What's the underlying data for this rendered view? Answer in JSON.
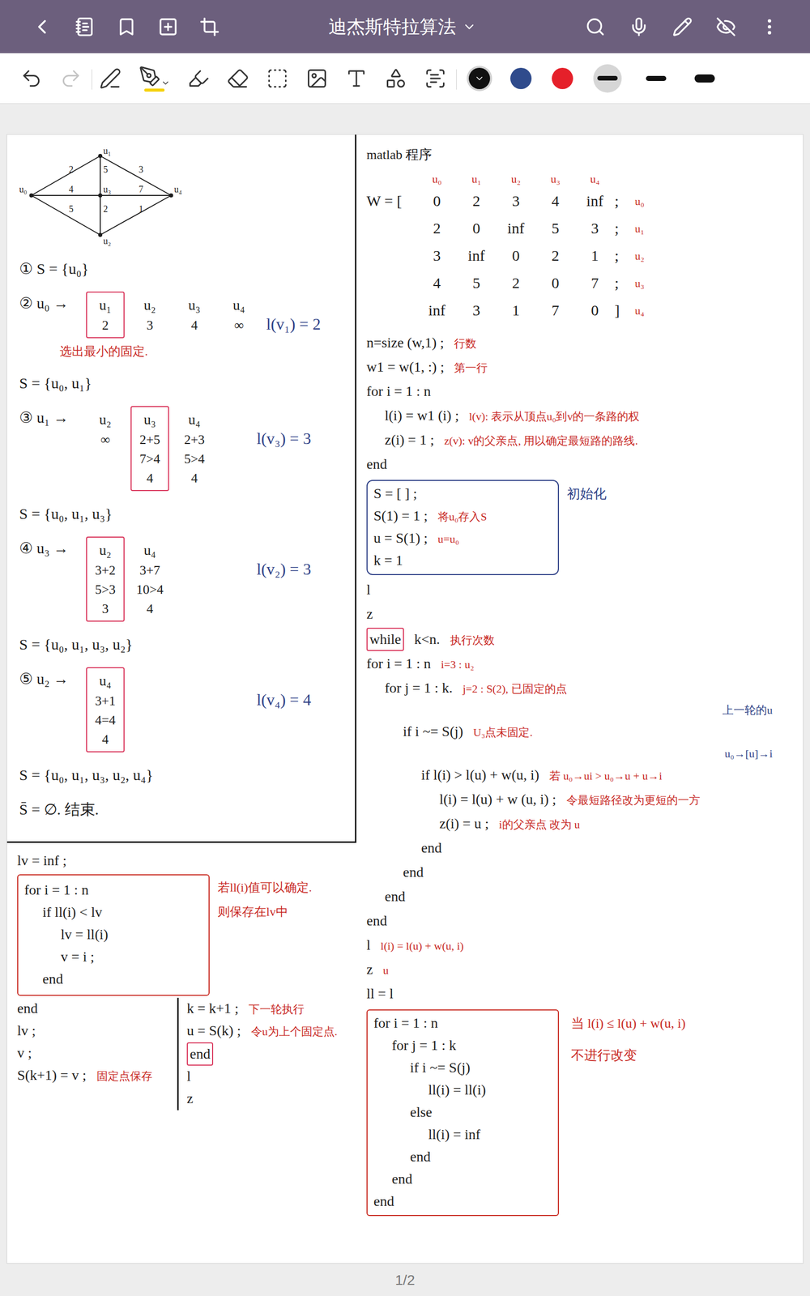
{
  "window": {
    "title": "迪杰斯特拉算法"
  },
  "toolbar": {
    "tools": [
      {
        "selected": false,
        "disabled": false
      },
      {
        "selected": false,
        "disabled": true
      },
      {
        "selected": false,
        "disabled": false
      },
      {
        "selected": true,
        "disabled": false
      },
      {
        "selected": false,
        "disabled": false
      },
      {
        "selected": false,
        "disabled": false
      },
      {
        "selected": false,
        "disabled": false
      },
      {
        "selected": false,
        "disabled": false
      },
      {
        "selected": false,
        "disabled": false
      },
      {
        "selected": false,
        "disabled": false
      },
      {
        "selected": false,
        "disabled": false
      }
    ],
    "colors": [
      {
        "color": "#111111",
        "selected": true
      },
      {
        "color": "#2f4b8c",
        "selected": false
      },
      {
        "color": "#e5202a",
        "selected": false
      }
    ],
    "strokes": [
      {
        "level": 0.4,
        "selected": true
      },
      {
        "level": 0.5,
        "selected": false
      },
      {
        "level": 1,
        "selected": false
      }
    ]
  },
  "graph": {
    "nodes": [
      {
        "label": "u₀"
      },
      {
        "label": "u₁"
      },
      {
        "label": "u₂"
      },
      {
        "label": "u₃"
      },
      {
        "label": "u₄"
      }
    ],
    "edges": [
      {
        "from": 0,
        "to": 1,
        "weight": "2"
      },
      {
        "from": 1,
        "to": 4,
        "weight": "3"
      },
      {
        "from": 0,
        "to": 2,
        "weight": "5"
      },
      {
        "from": 2,
        "to": 4,
        "weight": "1"
      },
      {
        "from": 1,
        "to": 3,
        "weight": "5"
      },
      {
        "from": 3,
        "to": 4,
        "weight": "7"
      },
      {
        "from": 0,
        "to": 3,
        "weight": "4"
      },
      {
        "from": 3,
        "to": 2,
        "weight": "2"
      }
    ]
  },
  "steps": [
    {
      "kind": "line",
      "text": "① S = {u₀}"
    },
    {
      "kind": "step",
      "label": "② u₀ →",
      "columns": [
        {
          "head": "u₁",
          "values": [
            "2"
          ],
          "boxed": true
        },
        {
          "head": "u₂",
          "values": [
            "3"
          ],
          "boxed": false
        },
        {
          "head": "u₃",
          "values": [
            "4"
          ],
          "boxed": false
        },
        {
          "head": "u₄",
          "values": [
            "∞"
          ],
          "boxed": false
        }
      ],
      "note": "选出最小的固定.",
      "result": "l(v₁) = 2"
    },
    {
      "kind": "line",
      "text": "S = {u₀, u₁}"
    },
    {
      "kind": "step",
      "label": "③ u₁ →",
      "columns": [
        {
          "head": "u₂",
          "values": [
            "∞"
          ],
          "boxed": false
        },
        {
          "head": "u₃",
          "values": [
            "2+5",
            "7>4",
            "4"
          ],
          "boxed": true
        },
        {
          "head": "u₄",
          "values": [
            "2+3",
            "5>4",
            "4"
          ],
          "boxed": false
        }
      ],
      "result": "l(v₃) = 3"
    },
    {
      "kind": "line",
      "text": "S = {u₀, u₁, u₃}"
    },
    {
      "kind": "step",
      "label": "④ u₃ →",
      "columns": [
        {
          "head": "u₂",
          "values": [
            "3+2",
            "5>3",
            "3"
          ],
          "boxed": true
        },
        {
          "head": "u₄",
          "values": [
            "3+7",
            "10>4",
            "4"
          ],
          "boxed": false
        }
      ],
      "result": "l(v₂) = 3"
    },
    {
      "kind": "line",
      "text": "S = {u₀, u₁, u₃, u₂}"
    },
    {
      "kind": "step",
      "label": "⑤ u₂ →",
      "columns": [
        {
          "head": "u₄",
          "values": [
            "3+1",
            "4=4",
            "4"
          ],
          "boxed": true
        }
      ],
      "result": "l(v₄) = 4"
    },
    {
      "kind": "line",
      "text": "S = {u₀, u₁, u₃, u₂, u₄}"
    },
    {
      "kind": "line",
      "text": "S̄ = ∅. 结束."
    }
  ],
  "program": {
    "title": "matlab 程序",
    "matrix": {
      "name": "W = [",
      "col_heads": [
        "u₀",
        "u₁",
        "u₂",
        "u₃",
        "u₄"
      ],
      "rows": [
        {
          "cells": [
            "0",
            "2",
            "3",
            "4",
            "inf"
          ],
          "end": ";",
          "label": "u₀"
        },
        {
          "cells": [
            "2",
            "0",
            "inf",
            "5",
            "3"
          ],
          "end": ";",
          "label": "u₁"
        },
        {
          "cells": [
            "3",
            "inf",
            "0",
            "2",
            "1"
          ],
          "end": ";",
          "label": "u₂"
        },
        {
          "cells": [
            "4",
            "5",
            "2",
            "0",
            "7"
          ],
          "end": ";",
          "label": "u₃"
        },
        {
          "cells": [
            "inf",
            "3",
            "1",
            "7",
            "0"
          ],
          "end": "]",
          "label": "u₄"
        }
      ]
    },
    "setup": [
      {
        "indent": 0,
        "code": "n=size (w,1) ;",
        "comment": "行数"
      },
      {
        "indent": 0,
        "code": "w1 = w(1, :) ;",
        "comment": "第一行"
      },
      {
        "indent": 0,
        "code": "for i = 1 : n"
      },
      {
        "indent": 1,
        "code": "l(i) = w1 (i) ;",
        "comment": "l(v): 表示从顶点u₀到v的一条路的权"
      },
      {
        "indent": 1,
        "code": "z(i) = 1 ;",
        "comment": "z(v): v的父亲点, 用以确定最短路的路线."
      },
      {
        "indent": 0,
        "code": "end"
      }
    ],
    "init": {
      "label": "初始化",
      "lines": [
        {
          "indent": 0,
          "code": "S = [ ] ;"
        },
        {
          "indent": 0,
          "code": "S(1) = 1 ;",
          "comment": "将u₀存入S"
        },
        {
          "indent": 0,
          "code": "u = S(1) ;",
          "comment": "u=u₀"
        },
        {
          "indent": 0,
          "code": "k = 1"
        }
      ]
    },
    "loop": [
      {
        "indent": 0,
        "code": "l"
      },
      {
        "indent": 0,
        "code": "z"
      },
      {
        "indent": 0,
        "box_word": "while",
        "code": "k<n.",
        "comment": "执行次数"
      },
      {
        "indent": 0,
        "code": "for i = 1 : n",
        "comment": "i=3 : u₂"
      },
      {
        "indent": 1,
        "code": "for j = 1 : k.",
        "comment": "j=2 : S(2), 已固定的点"
      },
      {
        "kind": "aside",
        "code": "上一轮的u"
      },
      {
        "indent": 2,
        "code": "if i ~= S(j)",
        "comment": "U₃点未固定."
      },
      {
        "kind": "aside",
        "code": "u₀→[u]→i"
      },
      {
        "indent": 3,
        "code": "if l(i) > l(u) + w(u, i)",
        "comment": "若 u₀→ui > u₀→u + u→i"
      },
      {
        "indent": 4,
        "code": "l(i) = l(u) + w (u, i) ;",
        "comment": "令最短路径改为更短的一方"
      },
      {
        "indent": 4,
        "code": "z(i) = u ;",
        "comment": "i的父亲点 改为 u"
      },
      {
        "indent": 3,
        "code": "end"
      },
      {
        "indent": 2,
        "code": "end"
      },
      {
        "indent": 1,
        "code": "end"
      },
      {
        "indent": 0,
        "code": "end"
      },
      {
        "indent": 0,
        "code": "l",
        "comment": "l(i) = l(u) + w(u, i)"
      },
      {
        "indent": 0,
        "code": "z",
        "comment": "u"
      },
      {
        "indent": 0,
        "code": "ll = l"
      }
    ],
    "mask": {
      "notes": [
        "当 l(i) ≤ l(u) + w(u, i)",
        "不进行改变"
      ],
      "lines": [
        {
          "indent": 0,
          "code": "for i = 1 : n"
        },
        {
          "indent": 1,
          "code": "for j = 1 : k"
        },
        {
          "indent": 2,
          "code": "if i ~= S(j)"
        },
        {
          "indent": 3,
          "code": "ll(i) = ll(i)"
        },
        {
          "indent": 2,
          "code": "else"
        },
        {
          "indent": 3,
          "code": "ll(i) = inf"
        },
        {
          "indent": 2,
          "code": "end"
        },
        {
          "indent": 1,
          "code": "end"
        },
        {
          "indent": 0,
          "code": "end"
        }
      ]
    }
  },
  "bottom": {
    "first": {
      "indent": 0,
      "code": "lv = inf ;"
    },
    "find_box": [
      {
        "indent": 0,
        "code": "for i = 1 : n"
      },
      {
        "indent": 1,
        "code": "if ll(i) < lv"
      },
      {
        "indent": 2,
        "code": "lv = ll(i)"
      },
      {
        "indent": 2,
        "code": "v = i ;"
      },
      {
        "indent": 1,
        "code": "end"
      }
    ],
    "find_notes": [
      "若ll(i)值可以确定.",
      "则保存在lv中"
    ],
    "after": [
      {
        "indent": 0,
        "code": "end"
      },
      {
        "indent": 0,
        "code": "lv ;"
      },
      {
        "indent": 0,
        "code": "v ;"
      },
      {
        "indent": 0,
        "code": "S(k+1) = v ;",
        "comment": "固定点保存"
      }
    ],
    "next": [
      {
        "indent": 0,
        "code": "k = k+1 ;",
        "comment": "下一轮执行"
      },
      {
        "indent": 0,
        "code": "u = S(k) ;",
        "comment": "令u为上个固定点."
      },
      {
        "indent": 0,
        "code": "end",
        "boxed": true
      },
      {
        "indent": 0,
        "code": "l"
      },
      {
        "indent": 0,
        "code": "z"
      }
    ]
  },
  "page_indicator": "1/2"
}
